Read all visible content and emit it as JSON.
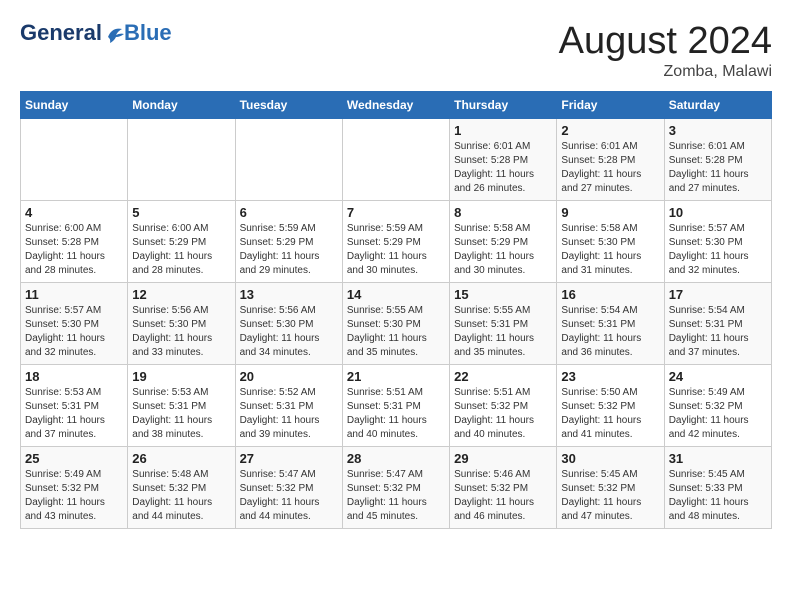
{
  "header": {
    "logo_line1": "General",
    "logo_line2": "Blue",
    "main_title": "August 2024",
    "subtitle": "Zomba, Malawi"
  },
  "days_of_week": [
    "Sunday",
    "Monday",
    "Tuesday",
    "Wednesday",
    "Thursday",
    "Friday",
    "Saturday"
  ],
  "weeks": [
    [
      {
        "day": "",
        "info": ""
      },
      {
        "day": "",
        "info": ""
      },
      {
        "day": "",
        "info": ""
      },
      {
        "day": "",
        "info": ""
      },
      {
        "day": "1",
        "info": "Sunrise: 6:01 AM\nSunset: 5:28 PM\nDaylight: 11 hours\nand 26 minutes."
      },
      {
        "day": "2",
        "info": "Sunrise: 6:01 AM\nSunset: 5:28 PM\nDaylight: 11 hours\nand 27 minutes."
      },
      {
        "day": "3",
        "info": "Sunrise: 6:01 AM\nSunset: 5:28 PM\nDaylight: 11 hours\nand 27 minutes."
      }
    ],
    [
      {
        "day": "4",
        "info": "Sunrise: 6:00 AM\nSunset: 5:28 PM\nDaylight: 11 hours\nand 28 minutes."
      },
      {
        "day": "5",
        "info": "Sunrise: 6:00 AM\nSunset: 5:29 PM\nDaylight: 11 hours\nand 28 minutes."
      },
      {
        "day": "6",
        "info": "Sunrise: 5:59 AM\nSunset: 5:29 PM\nDaylight: 11 hours\nand 29 minutes."
      },
      {
        "day": "7",
        "info": "Sunrise: 5:59 AM\nSunset: 5:29 PM\nDaylight: 11 hours\nand 30 minutes."
      },
      {
        "day": "8",
        "info": "Sunrise: 5:58 AM\nSunset: 5:29 PM\nDaylight: 11 hours\nand 30 minutes."
      },
      {
        "day": "9",
        "info": "Sunrise: 5:58 AM\nSunset: 5:30 PM\nDaylight: 11 hours\nand 31 minutes."
      },
      {
        "day": "10",
        "info": "Sunrise: 5:57 AM\nSunset: 5:30 PM\nDaylight: 11 hours\nand 32 minutes."
      }
    ],
    [
      {
        "day": "11",
        "info": "Sunrise: 5:57 AM\nSunset: 5:30 PM\nDaylight: 11 hours\nand 32 minutes."
      },
      {
        "day": "12",
        "info": "Sunrise: 5:56 AM\nSunset: 5:30 PM\nDaylight: 11 hours\nand 33 minutes."
      },
      {
        "day": "13",
        "info": "Sunrise: 5:56 AM\nSunset: 5:30 PM\nDaylight: 11 hours\nand 34 minutes."
      },
      {
        "day": "14",
        "info": "Sunrise: 5:55 AM\nSunset: 5:30 PM\nDaylight: 11 hours\nand 35 minutes."
      },
      {
        "day": "15",
        "info": "Sunrise: 5:55 AM\nSunset: 5:31 PM\nDaylight: 11 hours\nand 35 minutes."
      },
      {
        "day": "16",
        "info": "Sunrise: 5:54 AM\nSunset: 5:31 PM\nDaylight: 11 hours\nand 36 minutes."
      },
      {
        "day": "17",
        "info": "Sunrise: 5:54 AM\nSunset: 5:31 PM\nDaylight: 11 hours\nand 37 minutes."
      }
    ],
    [
      {
        "day": "18",
        "info": "Sunrise: 5:53 AM\nSunset: 5:31 PM\nDaylight: 11 hours\nand 37 minutes."
      },
      {
        "day": "19",
        "info": "Sunrise: 5:53 AM\nSunset: 5:31 PM\nDaylight: 11 hours\nand 38 minutes."
      },
      {
        "day": "20",
        "info": "Sunrise: 5:52 AM\nSunset: 5:31 PM\nDaylight: 11 hours\nand 39 minutes."
      },
      {
        "day": "21",
        "info": "Sunrise: 5:51 AM\nSunset: 5:31 PM\nDaylight: 11 hours\nand 40 minutes."
      },
      {
        "day": "22",
        "info": "Sunrise: 5:51 AM\nSunset: 5:32 PM\nDaylight: 11 hours\nand 40 minutes."
      },
      {
        "day": "23",
        "info": "Sunrise: 5:50 AM\nSunset: 5:32 PM\nDaylight: 11 hours\nand 41 minutes."
      },
      {
        "day": "24",
        "info": "Sunrise: 5:49 AM\nSunset: 5:32 PM\nDaylight: 11 hours\nand 42 minutes."
      }
    ],
    [
      {
        "day": "25",
        "info": "Sunrise: 5:49 AM\nSunset: 5:32 PM\nDaylight: 11 hours\nand 43 minutes."
      },
      {
        "day": "26",
        "info": "Sunrise: 5:48 AM\nSunset: 5:32 PM\nDaylight: 11 hours\nand 44 minutes."
      },
      {
        "day": "27",
        "info": "Sunrise: 5:47 AM\nSunset: 5:32 PM\nDaylight: 11 hours\nand 44 minutes."
      },
      {
        "day": "28",
        "info": "Sunrise: 5:47 AM\nSunset: 5:32 PM\nDaylight: 11 hours\nand 45 minutes."
      },
      {
        "day": "29",
        "info": "Sunrise: 5:46 AM\nSunset: 5:32 PM\nDaylight: 11 hours\nand 46 minutes."
      },
      {
        "day": "30",
        "info": "Sunrise: 5:45 AM\nSunset: 5:32 PM\nDaylight: 11 hours\nand 47 minutes."
      },
      {
        "day": "31",
        "info": "Sunrise: 5:45 AM\nSunset: 5:33 PM\nDaylight: 11 hours\nand 48 minutes."
      }
    ]
  ]
}
